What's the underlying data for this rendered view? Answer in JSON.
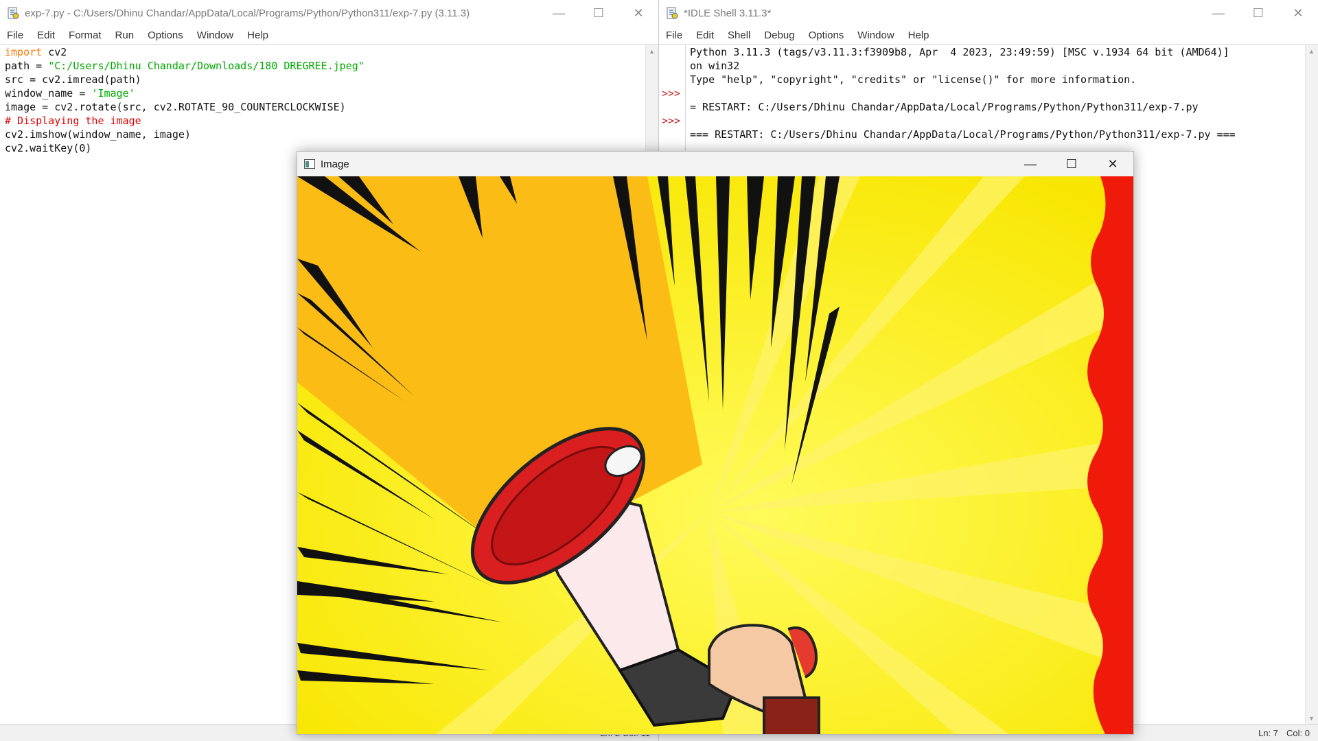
{
  "editor": {
    "title": "exp-7.py - C:/Users/Dhinu Chandar/AppData/Local/Programs/Python/Python311/exp-7.py (3.11.3)",
    "menu": [
      "File",
      "Edit",
      "Format",
      "Run",
      "Options",
      "Window",
      "Help"
    ],
    "code": {
      "l1_kw": "import",
      "l1_rest": " cv2",
      "l2_pre": "path = ",
      "l2_str": "\"C:/Users/Dhinu Chandar/Downloads/180 DREGREE.jpeg\"",
      "l3": "src = cv2.imread(path)",
      "l4_pre": "window_name = ",
      "l4_str": "'Image'",
      "l5": "image = cv2.rotate(src, cv2.ROTATE_90_COUNTERCLOCKWISE)",
      "l6_cmt": "# Displaying the image",
      "l7": "cv2.imshow(window_name, image)",
      "l8": "cv2.waitKey(0)"
    },
    "status": "Ln: 2   Col: 11"
  },
  "shell": {
    "title": "*IDLE Shell 3.11.3*",
    "menu": [
      "File",
      "Edit",
      "Shell",
      "Debug",
      "Options",
      "Window",
      "Help"
    ],
    "prompt": ">>>",
    "lines": {
      "l1": "Python 3.11.3 (tags/v3.11.3:f3909b8, Apr  4 2023, 23:49:59) [MSC v.1934 64 bit (AMD64)]",
      "l2": "on win32",
      "l3": "Type \"help\", \"copyright\", \"credits\" or \"license()\" for more information.",
      "l5": "= RESTART: C:/Users/Dhinu Chandar/AppData/Local/Programs/Python/Python311/exp-7.py",
      "l7": "=== RESTART: C:/Users/Dhinu Chandar/AppData/Local/Programs/Python/Python311/exp-7.py ==="
    },
    "status": {
      "ln": "Ln: 7",
      "col": "Col: 0"
    }
  },
  "image_window": {
    "title": "Image"
  },
  "colors": {
    "keyword": "#ff7700",
    "string": "#00aa00",
    "comment": "#dd0000",
    "prompt": "#c02020"
  }
}
